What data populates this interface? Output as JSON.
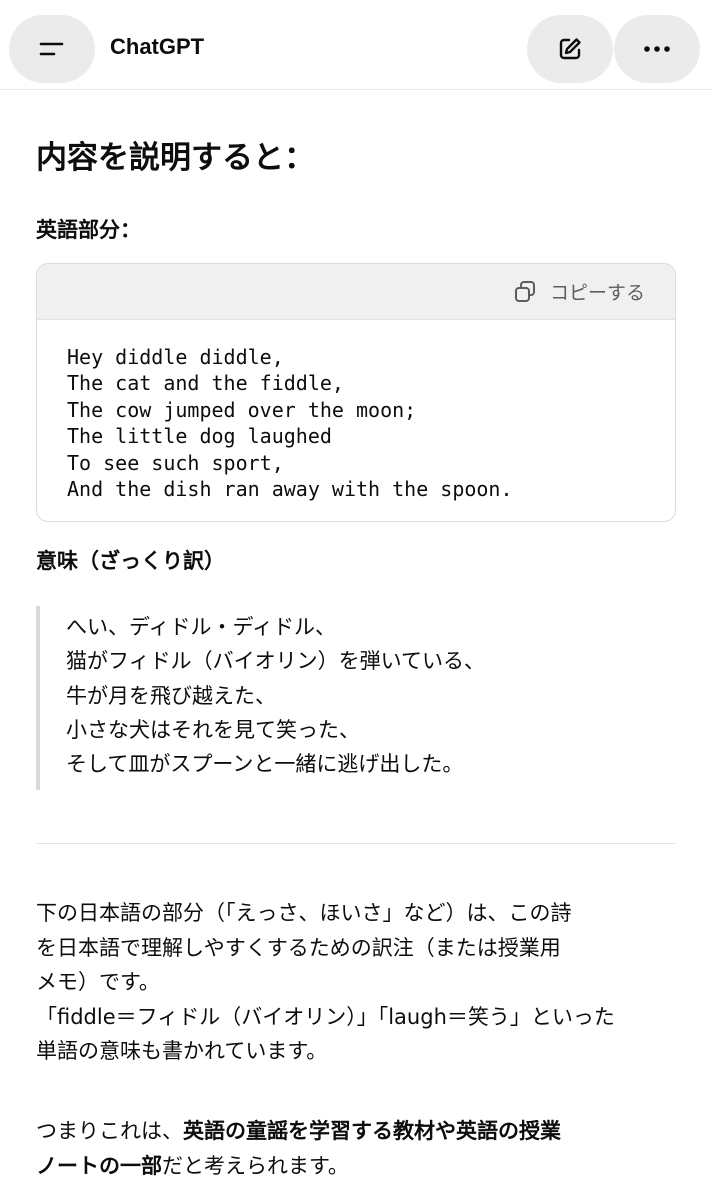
{
  "header": {
    "title": "ChatGPT",
    "menu_icon": "menu-icon",
    "edit_icon": "edit-icon",
    "more_icon": "more-icon"
  },
  "content": {
    "heading": "内容を説明すると：",
    "english_section_title": "英語部分：",
    "code_block": {
      "copy_label": "コピーする",
      "lines": [
        "Hey diddle diddle,",
        "The cat and the fiddle,",
        "The cow jumped over the moon;",
        "The little dog laughed",
        "To see such sport,",
        "And the dish ran away with the spoon."
      ]
    },
    "meaning_section_title": "意味（ざっくり訳）",
    "quote_lines": [
      "へい、ディドル・ディドル、",
      "猫がフィドル（バイオリン）を弾いている、",
      "牛が月を飛び越えた、",
      "小さな犬はそれを見て笑った、",
      "そして皿がスプーンと一緒に逃げ出した。"
    ],
    "paragraph1_lines": [
      "下の日本語の部分（「えっさ、ほいさ」など）は、この詩",
      "を日本語で理解しやすくするための訳注（または授業用",
      "メモ）です。",
      "「fiddle＝フィドル（バイオリン）」「laugh＝笑う」といった",
      "単語の意味も書かれています。"
    ],
    "paragraph2": {
      "line1_plain": "つまりこれは、",
      "line1_bold": "英語の童謡を学習する教材や英語の授業",
      "line2_bold": "ノートの一部",
      "line2_plain": "だと考えられます。"
    }
  }
}
